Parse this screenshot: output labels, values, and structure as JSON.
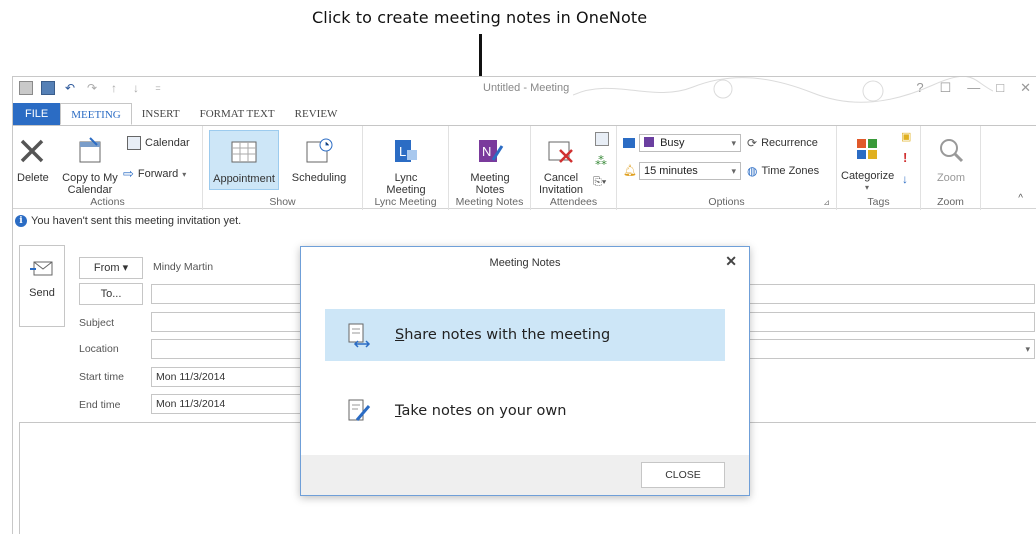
{
  "callout": {
    "text": "Click to create meeting notes in OneNote"
  },
  "window": {
    "title": "Untitled - Meeting",
    "controls": [
      "?",
      "☐",
      "—",
      "□",
      "✕"
    ]
  },
  "tabs": [
    {
      "label": "FILE"
    },
    {
      "label": "MEETING"
    },
    {
      "label": "INSERT"
    },
    {
      "label": "FORMAT TEXT"
    },
    {
      "label": "REVIEW"
    }
  ],
  "ribbon": {
    "actions": {
      "label": "Actions",
      "delete": "Delete",
      "copy_line1": "Copy to My",
      "copy_line2": "Calendar",
      "calendar": "Calendar",
      "forward": "Forward"
    },
    "show": {
      "label": "Show",
      "appointment": "Appointment",
      "scheduling": "Scheduling"
    },
    "lync": {
      "label": "Lync Meeting",
      "btn_line1": "Lync",
      "btn_line2": "Meeting"
    },
    "meeting_notes": {
      "label": "Meeting Notes",
      "btn_line1": "Meeting",
      "btn_line2": "Notes"
    },
    "attendees": {
      "label": "Attendees",
      "cancel_line1": "Cancel",
      "cancel_line2": "Invitation"
    },
    "options": {
      "label": "Options",
      "show_as": "Busy",
      "reminder": "15 minutes",
      "recurrence": "Recurrence",
      "time_zones": "Time Zones"
    },
    "tags": {
      "label": "Tags",
      "categorize": "Categorize"
    },
    "zoom": {
      "label": "Zoom",
      "zoom": "Zoom"
    }
  },
  "info_bar": {
    "text": "You haven't sent this meeting invitation yet."
  },
  "form": {
    "send": "Send",
    "from_button": "From ▾",
    "from_value": "Mindy Martin",
    "to_button": "To...",
    "subject_label": "Subject",
    "location_label": "Location",
    "start_label": "Start time",
    "start_value": "Mon 11/3/2014",
    "end_label": "End time",
    "end_value": "Mon 11/3/2014"
  },
  "dialog": {
    "title": "Meeting Notes",
    "option1_key": "S",
    "option1_rest": "hare notes with the meeting",
    "option2_key": "T",
    "option2_rest": "ake notes on your own",
    "close_button": "CLOSE"
  },
  "colors": {
    "accent": "#2b6cc4",
    "selection": "#cde6f7",
    "onenote": "#7a3a9c"
  }
}
